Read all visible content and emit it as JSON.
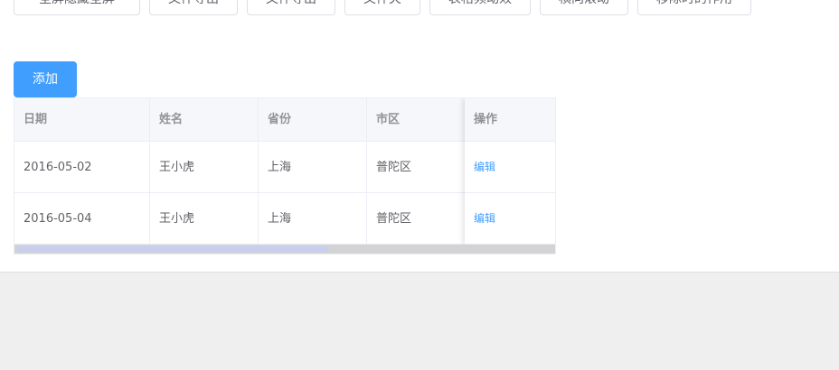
{
  "toolbar": {
    "buttons": [
      "全屏隐藏全屏",
      "文件导出",
      "文件导出",
      "文件夹",
      "表格频动效",
      "横向滚动",
      "移除时的作用"
    ]
  },
  "add_button": {
    "label": "添加"
  },
  "table": {
    "headers": [
      "日期",
      "姓名",
      "省份",
      "市区",
      "操作"
    ],
    "rows": [
      {
        "date": "2016-05-02",
        "name": "王小虎",
        "province": "上海",
        "district": "普陀区",
        "action": "编辑"
      },
      {
        "date": "2016-05-04",
        "name": "王小虎",
        "province": "上海",
        "district": "普陀区",
        "action": "编辑"
      }
    ],
    "scroll_position": 0.58
  },
  "colors": {
    "primary": "#409eff",
    "header_bg": "#f5f7fa",
    "border": "#ebeef5",
    "footer_bg": "#efefef"
  }
}
